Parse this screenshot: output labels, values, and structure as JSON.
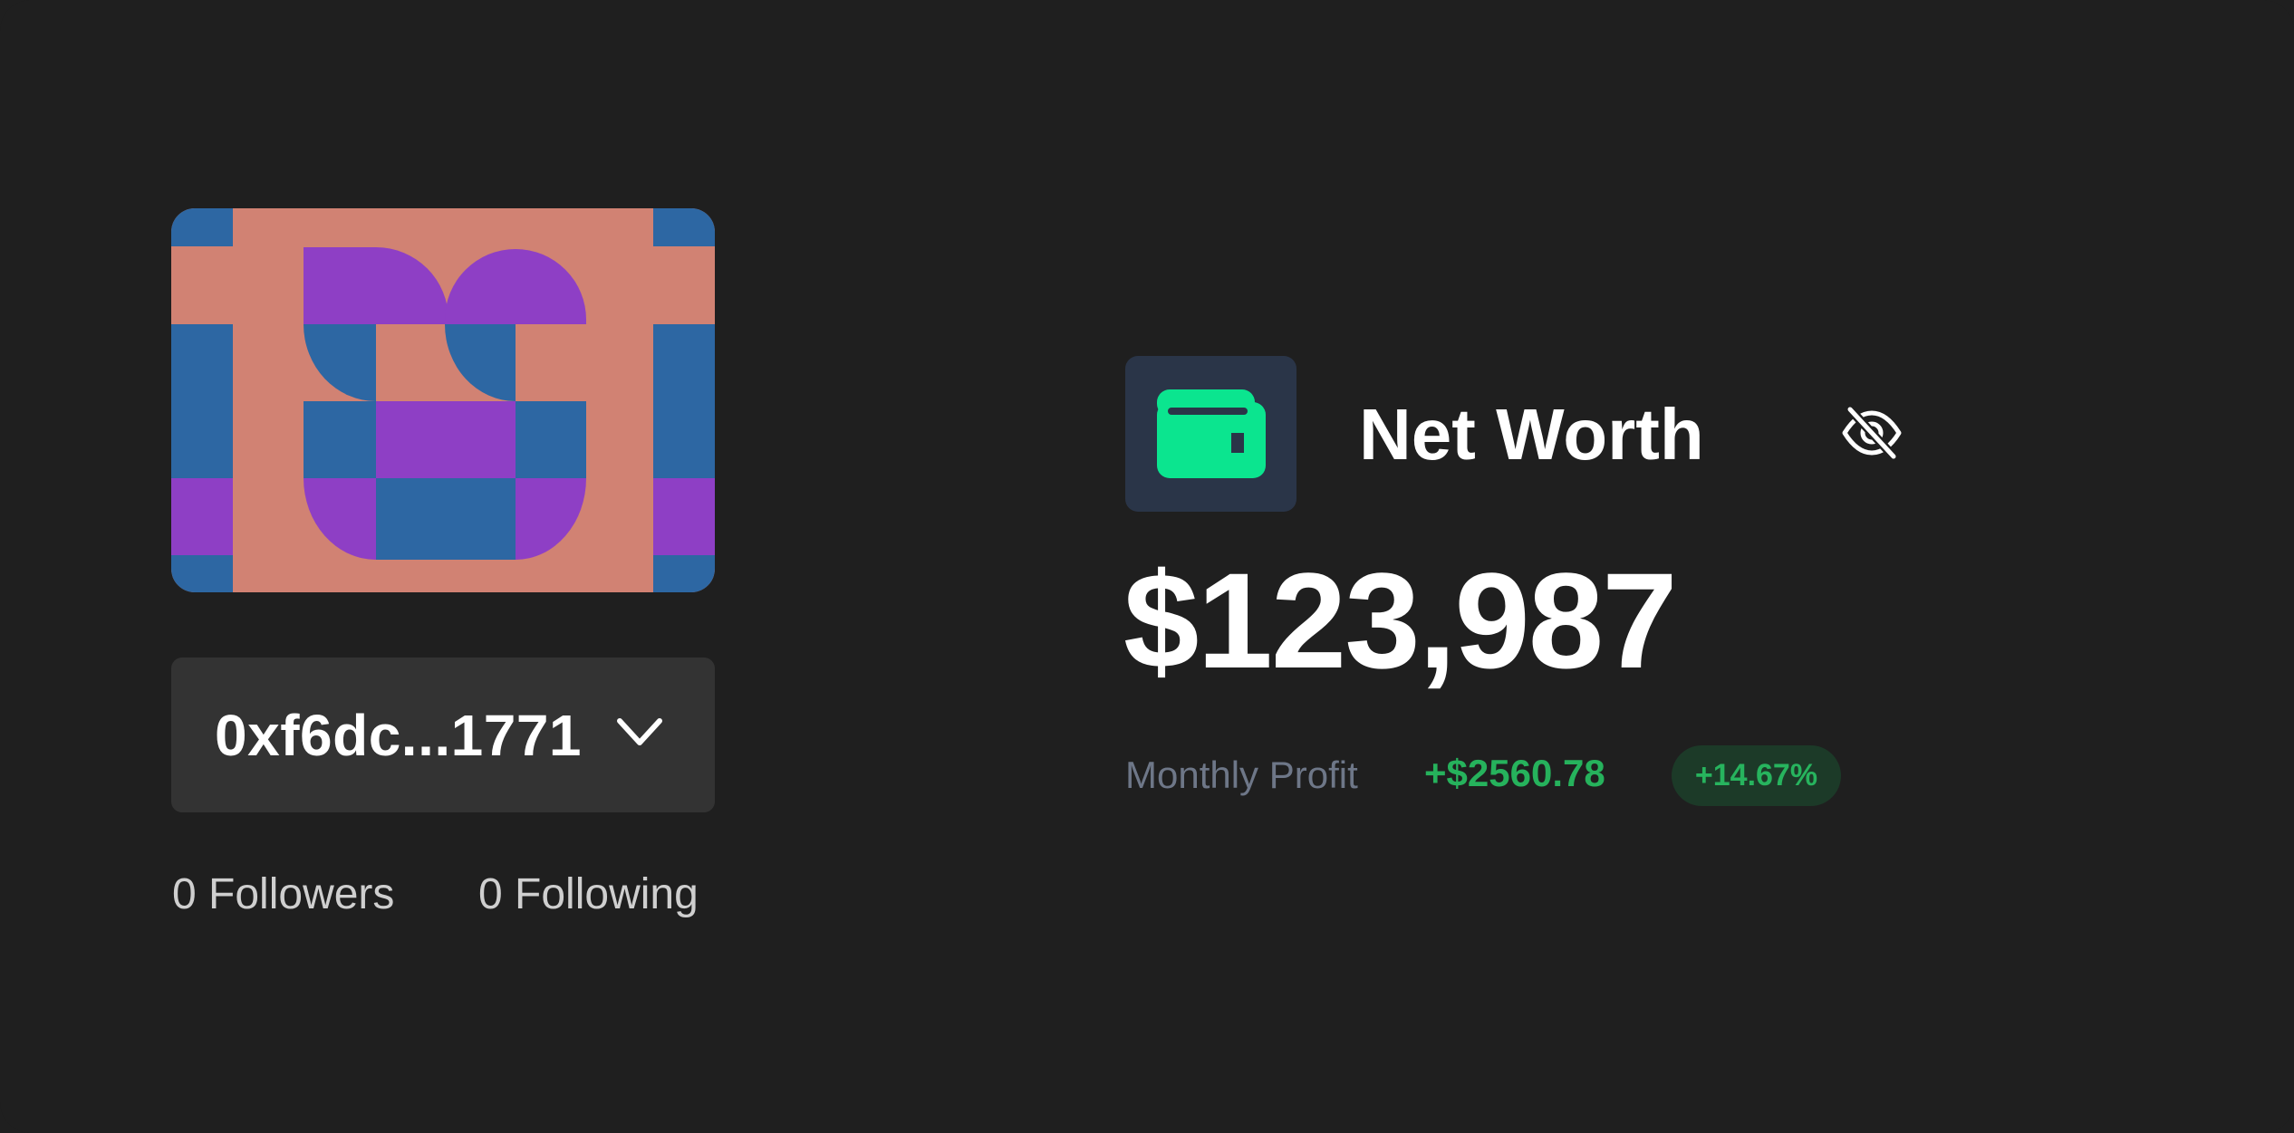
{
  "profile": {
    "address": "0xf6dc...1771",
    "followers_label": "0 Followers",
    "following_label": "0 Following"
  },
  "net_worth": {
    "title": "Net Worth",
    "value": "$123,987",
    "monthly_profit_label": "Monthly Profit",
    "monthly_profit_value": "+$2560.78",
    "monthly_profit_percent": "+14.67%"
  },
  "icons": {
    "wallet": "wallet-icon",
    "visibility_toggle": "eye-off-icon",
    "dropdown": "chevron-down-icon"
  },
  "colors": {
    "background": "#1f1f1f",
    "accent_green": "#0be58f",
    "profit_green": "#26b25c",
    "badge_bg": "#1c3a28",
    "wallet_tile_bg": "#2a3548",
    "avatar_salmon": "#d18273",
    "avatar_blue": "#2d67a3",
    "avatar_purple": "#8e3fc5"
  }
}
